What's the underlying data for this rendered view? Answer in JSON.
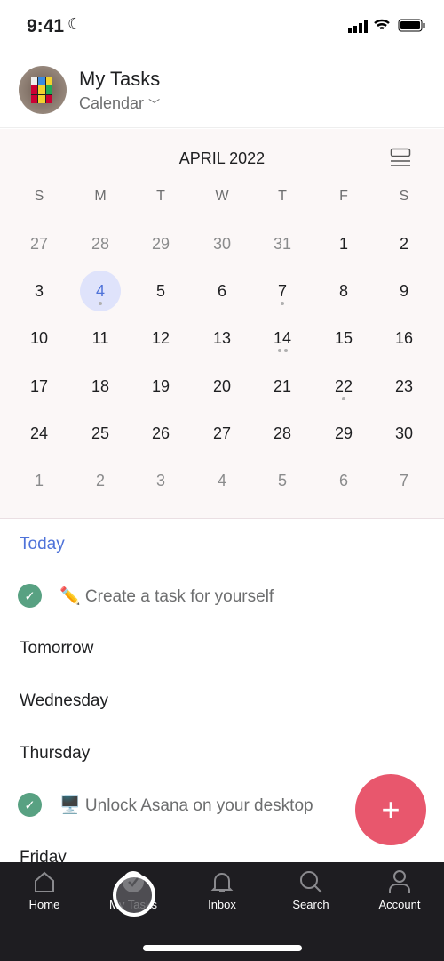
{
  "status": {
    "time": "9:41"
  },
  "header": {
    "title": "My Tasks",
    "view": "Calendar"
  },
  "calendar": {
    "month": "APRIL 2022",
    "weekdays": [
      "S",
      "M",
      "T",
      "W",
      "T",
      "F",
      "S"
    ],
    "weeks": [
      [
        "27",
        "28",
        "29",
        "30",
        "31",
        "1",
        "2"
      ],
      [
        "3",
        "4",
        "5",
        "6",
        "7",
        "8",
        "9"
      ],
      [
        "10",
        "11",
        "12",
        "13",
        "14",
        "15",
        "16"
      ],
      [
        "17",
        "18",
        "19",
        "20",
        "21",
        "22",
        "23"
      ],
      [
        "24",
        "25",
        "26",
        "27",
        "28",
        "29",
        "30"
      ],
      [
        "1",
        "2",
        "3",
        "4",
        "5",
        "6",
        "7"
      ]
    ],
    "selected": "4",
    "task_dots": {
      "4": 1,
      "7": 1,
      "14": 2,
      "22": 1
    }
  },
  "tasks": {
    "today": "Today",
    "task1": "✏️ Create a task for yourself",
    "tomorrow": "Tomorrow",
    "wednesday": "Wednesday",
    "thursday": "Thursday",
    "task2": "🖥️ Unlock Asana on your desktop",
    "friday": "Friday"
  },
  "fab": "+",
  "tabs": [
    "Home",
    "My Tasks",
    "Inbox",
    "Search",
    "Account"
  ],
  "colors": {
    "accent": "#4f73d9",
    "fab": "#e8576d",
    "check": "#58a182"
  }
}
